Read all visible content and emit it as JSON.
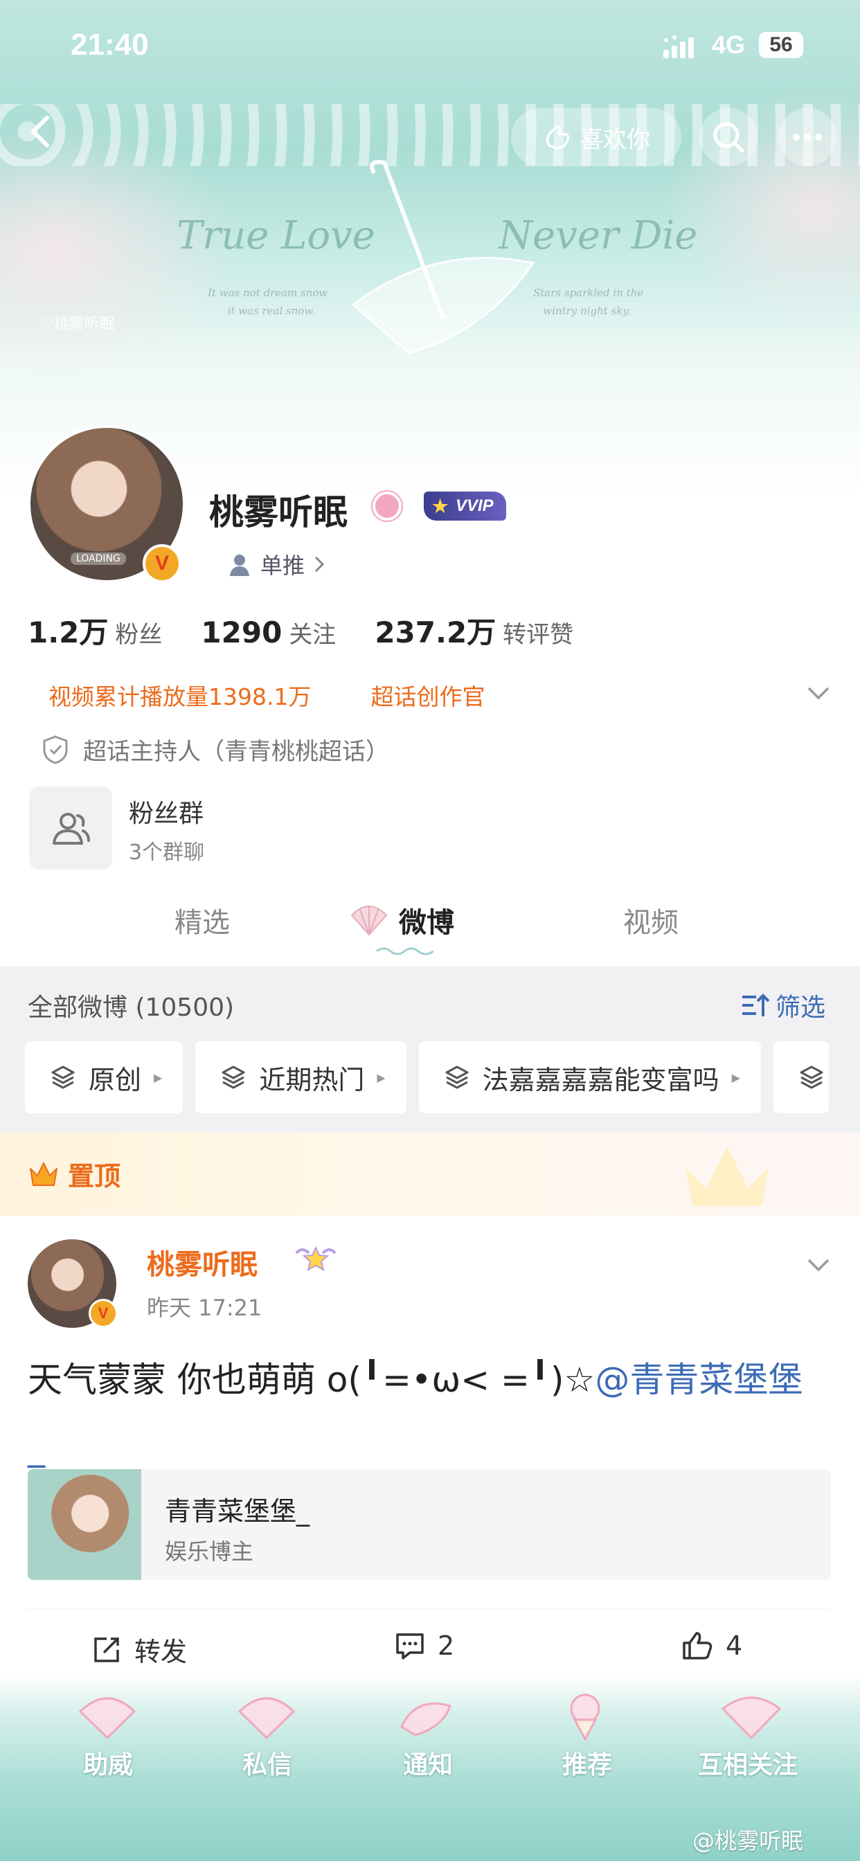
{
  "status_bar": {
    "time": "21:40",
    "network": "4G",
    "battery": "56"
  },
  "nav": {
    "like_label": "喜欢你",
    "icons": [
      "back-icon",
      "heart-hand-icon",
      "search-icon",
      "more-icon"
    ]
  },
  "banner": {
    "script_left": "True Love",
    "script_right": "Never Die",
    "poem_left": "It was not dream snow\n      it was real snow.",
    "poem_right": "Stars sparkled in the\n   wintry night sky.",
    "watermark_name": "♡桃雾听眠"
  },
  "profile": {
    "name": "桃雾听眠",
    "vip": "VVIP",
    "avatar_tag": "LOADING",
    "verified": "V",
    "tag_label": "单推",
    "stats": [
      {
        "num": "1.2万",
        "label": "粉丝"
      },
      {
        "num": "1290",
        "label": "关注"
      },
      {
        "num": "237.2万",
        "label": "转评赞"
      }
    ],
    "links": [
      "视频累计播放量1398.1万",
      "超话创作官"
    ],
    "host": "超话主持人（青青桃桃超话）",
    "fans_group": {
      "title": "粉丝群",
      "sub": "3个群聊"
    }
  },
  "tabs": [
    "精选",
    "微博",
    "视频"
  ],
  "feed": {
    "title": "全部微博 (10500)",
    "filter": "筛选",
    "chips": [
      "原创",
      "近期热门",
      "法嘉嘉嘉嘉能变富吗"
    ]
  },
  "pinned": {
    "label": "置顶"
  },
  "post": {
    "author": "桃雾听眠",
    "time": "昨天 17:21",
    "text": "天气蒙蒙 你也萌萌 o(╹=•ω< =╹)☆",
    "mention_line1": "@青青菜堡堡",
    "mention_line2": "_",
    "card": {
      "title": "青青菜堡堡_",
      "subtitle": "娱乐博主"
    },
    "actions": {
      "repost": "转发",
      "comments": "2",
      "likes": "4"
    }
  },
  "bottom_bar": [
    "助威",
    "私信",
    "通知",
    "推荐",
    "互相关注"
  ],
  "watermark": "@桃雾听眠",
  "colors": {
    "accent_orange": "#ec6b1c",
    "link_blue": "#3d6bb5",
    "banner_teal": "#a9ddd4"
  }
}
